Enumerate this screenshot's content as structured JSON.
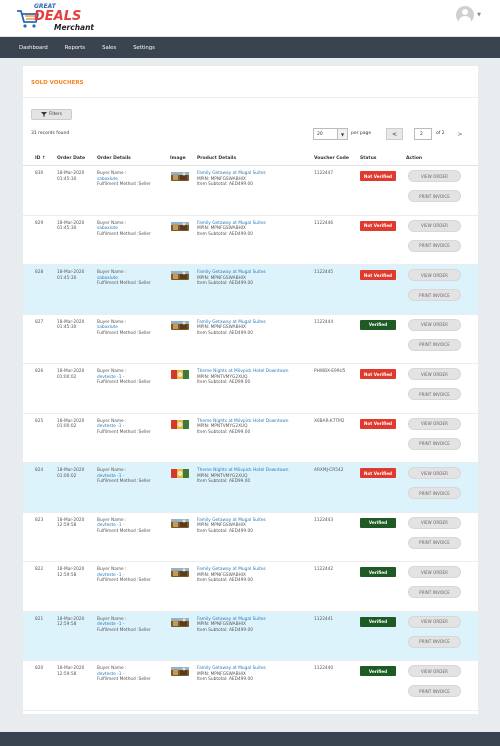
{
  "brand": {
    "great": "GREAT",
    "deals": "DEALS",
    "merchant": "Merchant"
  },
  "nav": [
    "Dashboard",
    "Reports",
    "Sales",
    "Settings"
  ],
  "page_title": "SOLD VOUCHERS",
  "filters_label": "Filters",
  "records_text": "31 records found",
  "pagination": {
    "per_page_value": "20",
    "per_page_label": "per page",
    "current_page": "2",
    "of_pages": "of 2",
    "prev": "<",
    "next": ">"
  },
  "columns": {
    "id": "ID",
    "order_date": "Order Date",
    "order_details": "Order Details",
    "image": "Image",
    "product_details": "Product Details",
    "voucher_code": "Voucher Code",
    "status": "Status",
    "action": "Action"
  },
  "sort_indicator": "↑",
  "labels": {
    "buyer_name": "Buyer Name :",
    "fulfilment": "Fulfilment Method :Seller",
    "view_order": "VIEW ORDER",
    "print_invoice": "PRINT INVOICE"
  },
  "status_colors": {
    "Not Verified": "#e03a2f",
    "Verified": "#1d5a24"
  },
  "rows": [
    {
      "id": "830",
      "date": "18-Mar-2020",
      "time": "01:45:30",
      "buyer": "saboxlute",
      "product": "Family Getaway at Mugal Suites",
      "mpin": "MPIN: MPNFGSWABHIX",
      "subtotal": "Item Subtotal: AED499.00",
      "voucher": "1122447",
      "status": "Not Verified",
      "image": "mugal",
      "highlighted": false
    },
    {
      "id": "829",
      "date": "18-Mar-2020",
      "time": "01:45:30",
      "buyer": "saboxlute",
      "product": "Family Getaway at Mugal Suites",
      "mpin": "MPIN: MPNFGSWABHIX",
      "subtotal": "Item Subtotal: AED499.00",
      "voucher": "1122446",
      "status": "Not Verified",
      "image": "mugal",
      "highlighted": false
    },
    {
      "id": "828",
      "date": "18-Mar-2020",
      "time": "01:45:30",
      "buyer": "saboxlute",
      "product": "Family Getaway at Mugal Suites",
      "mpin": "MPIN: MPNFGSWABHIX",
      "subtotal": "Item Subtotal: AED499.00",
      "voucher": "1122445",
      "status": "Not Verified",
      "image": "mugal",
      "highlighted": true
    },
    {
      "id": "827",
      "date": "18-Mar-2020",
      "time": "01:45:30",
      "buyer": "saboxlute",
      "product": "Family Getaway at Mugal Suites",
      "mpin": "MPIN: MPNFGSWABHIX",
      "subtotal": "Item Subtotal: AED499.00",
      "voucher": "1122444",
      "status": "Verified",
      "image": "mugal",
      "highlighted": false
    },
    {
      "id": "826",
      "date": "18-Mar-2020",
      "time": "01:00:02",
      "buyer": "devteste -1 -",
      "product": "Theme Nights at Mövpick Hotel Downtown",
      "mpin": "MPIN: MPNTVMYG2XUQ",
      "subtotal": "Item Subtotal: AED99.00",
      "voucher": "PHWBX-E99U5",
      "status": "Not Verified",
      "image": "theme",
      "highlighted": false
    },
    {
      "id": "825",
      "date": "18-Mar-2020",
      "time": "01:00:02",
      "buyer": "devteste -1 -",
      "product": "Theme Nights at Mövpick Hotel Downtown",
      "mpin": "MPIN: MPNTVMYG2XUQ",
      "subtotal": "Item Subtotal: AED99.00",
      "voucher": "X6BAR-K7TM2",
      "status": "Not Verified",
      "image": "theme",
      "highlighted": false
    },
    {
      "id": "824",
      "date": "18-Mar-2020",
      "time": "01:00:02",
      "buyer": "devteste -1 -",
      "product": "Theme Nights at Mövpick Hotel Downtown",
      "mpin": "MPIN: MPNTVMYG2XUQ",
      "subtotal": "Item Subtotal: AED99.00",
      "voucher": "ARXMJ-CR542",
      "status": "Not Verified",
      "image": "theme",
      "highlighted": true
    },
    {
      "id": "823",
      "date": "18-Mar-2020",
      "time": "12:59:58",
      "buyer": "devteste -1 -",
      "product": "Family Getaway at Mugal Suites",
      "mpin": "MPIN: MPNFGSWABHIX",
      "subtotal": "Item Subtotal: AED499.00",
      "voucher": "1122443",
      "status": "Verified",
      "image": "mugal",
      "highlighted": false
    },
    {
      "id": "822",
      "date": "18-Mar-2020",
      "time": "12:59:58",
      "buyer": "devteste -1 -",
      "product": "Family Getaway at Mugal Suites",
      "mpin": "MPIN: MPNFGSWABHIX",
      "subtotal": "Item Subtotal: AED499.00",
      "voucher": "1122442",
      "status": "Verified",
      "image": "mugal",
      "highlighted": false
    },
    {
      "id": "821",
      "date": "18-Mar-2020",
      "time": "12:59:58",
      "buyer": "devteste -1 -",
      "product": "Family Getaway at Mugal Suites",
      "mpin": "MPIN: MPNFGSWABHIX",
      "subtotal": "Item Subtotal: AED499.00",
      "voucher": "1122441",
      "status": "Verified",
      "image": "mugal",
      "highlighted": true
    },
    {
      "id": "820",
      "date": "18-Mar-2020",
      "time": "12:59:58",
      "buyer": "devteste -1 -",
      "product": "Family Getaway at Mugal Suites",
      "mpin": "MPIN: MPNFGSWABHIX",
      "subtotal": "Item Subtotal: AED499.00",
      "voucher": "1122440",
      "status": "Verified",
      "image": "mugal",
      "highlighted": false
    }
  ]
}
